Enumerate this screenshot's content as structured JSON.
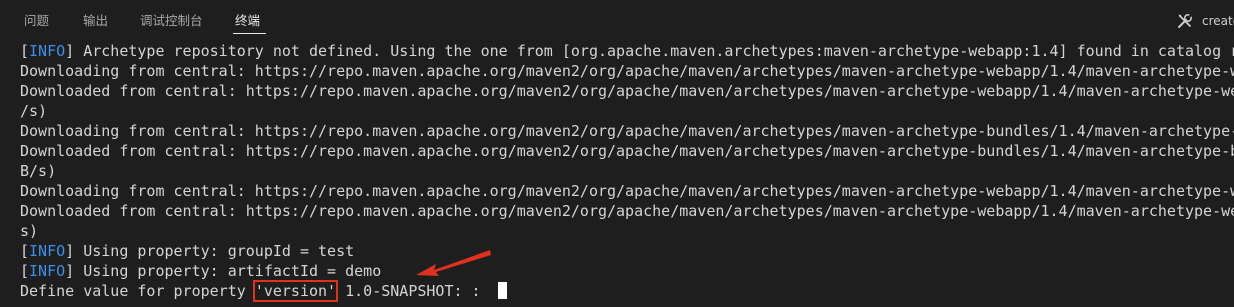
{
  "tabs": [
    {
      "label": "问题"
    },
    {
      "label": "输出"
    },
    {
      "label": "调试控制台"
    },
    {
      "label": "终端",
      "active": true
    }
  ],
  "toolbar": {
    "create_label": "create",
    "create_icon": "tools-icon"
  },
  "terminal": {
    "info_tag": "INFO",
    "lines": [
      "Archetype repository not defined. Using the one from [org.apache.maven.archetypes:maven-archetype-webapp:1.4] found in catalog r",
      "Downloading from central: https://repo.maven.apache.org/maven2/org/apache/maven/archetypes/maven-archetype-webapp/1.4/maven-archetype-w",
      "Downloaded from central: https://repo.maven.apache.org/maven2/org/apache/maven/archetypes/maven-archetype-webapp/1.4/maven-archetype-we",
      "/s)",
      "Downloading from central: https://repo.maven.apache.org/maven2/org/apache/maven/archetypes/maven-archetype-bundles/1.4/maven-archetype-",
      "Downloaded from central: https://repo.maven.apache.org/maven2/org/apache/maven/archetypes/maven-archetype-bundles/1.4/maven-archetype-b",
      "B/s)",
      "Downloading from central: https://repo.maven.apache.org/maven2/org/apache/maven/archetypes/maven-archetype-webapp/1.4/maven-archetype-w",
      "Downloaded from central: https://repo.maven.apache.org/maven2/org/apache/maven/archetypes/maven-archetype-webapp/1.4/maven-archetype-we",
      "s)",
      "Using property: groupId = test",
      "Using property: artifactId = demo"
    ],
    "prompt": {
      "before": "Define value for property ",
      "highlighted": "'version'",
      "after": " 1.0-SNAPSHOT: : "
    }
  },
  "colors": {
    "background": "#1e1e1e",
    "text": "#d4d4d4",
    "info": "#3b8eea",
    "annotation_red": "#e0301e"
  }
}
